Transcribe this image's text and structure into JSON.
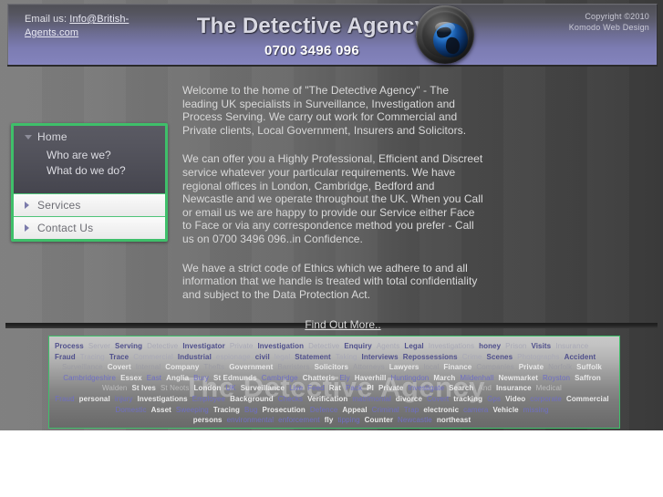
{
  "header": {
    "email_label": "Email us:",
    "email_link": "Info@British-Agents.com",
    "title": "The Detective Agency",
    "phone": "0700 3496 096",
    "copyright_line1": "Copyright ©2010",
    "copyright_line2": "Komodo Web Design",
    "logo_icon": "camera-lens-globe-icon",
    "accent_color": "#8080b8"
  },
  "sidebar": {
    "accent_color": "#3fbf6a",
    "home": {
      "label": "Home",
      "icon": "chevron-down-icon",
      "sub_items": [
        {
          "label": "Who are we?"
        },
        {
          "label": "What do we do?"
        }
      ]
    },
    "items": [
      {
        "label": "Services",
        "icon": "chevron-right-icon"
      },
      {
        "label": "Contact Us",
        "icon": "chevron-right-icon"
      }
    ]
  },
  "main": {
    "paragraphs": [
      "Welcome to the home of \"The Detective Agency\" - The leading UK specialists in Surveillance, Investigation and Process Serving. We carry out work for Commercial and Private clients, Local Government, Insurers and Solicitors.",
      "We can offer you a Highly Professional, Efficient and Discreet service whatever your particular requirements. We have regional offices in London, Cambridge, Bedford and Newcastle and we operate throughout the UK. When you Call or email us we are happy to provide our Service either Face to Face or via any correspondence method you prefer - Call us on 0700 3496 096..in Confidence.",
      "We have a strict code of Ethics which we adhere to and all information that we handle is treated with total confidentiality and subject to the Data Protection Act."
    ],
    "find_out_more": "Find Out More.."
  },
  "footer": {
    "watermark": "The Detective Agency",
    "border_color": "#3fbf6a",
    "tag_rows": [
      [
        {
          "text": "Process",
          "tier": "t-strong"
        },
        {
          "text": "Server",
          "tier": "t-faint"
        },
        {
          "text": "Serving",
          "tier": "t-strong"
        },
        {
          "text": "Detective",
          "tier": "t-faint"
        },
        {
          "text": "Investigator",
          "tier": "t-strong"
        },
        {
          "text": "Private",
          "tier": "t-faint"
        },
        {
          "text": "Investigation",
          "tier": "t-strong"
        },
        {
          "text": "Detective",
          "tier": "t-faint"
        },
        {
          "text": "Enquiry",
          "tier": "t-strong"
        },
        {
          "text": "Agents",
          "tier": "t-faint"
        },
        {
          "text": "Legal",
          "tier": "t-strong"
        },
        {
          "text": "Investigations",
          "tier": "t-faint"
        },
        {
          "text": "honey",
          "tier": "t-strong"
        },
        {
          "text": "Prison",
          "tier": "t-faint"
        },
        {
          "text": "Visits",
          "tier": "t-strong"
        },
        {
          "text": "Insurance",
          "tier": "t-faint"
        }
      ],
      [
        {
          "text": "Fraud",
          "tier": "t-strong"
        },
        {
          "text": "Tracing",
          "tier": "t-faint"
        },
        {
          "text": "Trace",
          "tier": "t-strong"
        },
        {
          "text": "Commercial",
          "tier": "t-faint"
        },
        {
          "text": "Industrial",
          "tier": "t-strong"
        },
        {
          "text": "espionage",
          "tier": "t-faint"
        },
        {
          "text": "civil",
          "tier": "t-strong"
        },
        {
          "text": "legal",
          "tier": "t-faint"
        },
        {
          "text": "Statement",
          "tier": "t-strong"
        },
        {
          "text": "Taking",
          "tier": "t-faint"
        },
        {
          "text": "Interviews",
          "tier": "t-strong"
        },
        {
          "text": "Repossessions",
          "tier": "t-strong"
        },
        {
          "text": "Crime",
          "tier": "t-faint"
        },
        {
          "text": "Scenes",
          "tier": "t-strong"
        },
        {
          "text": "Photographs",
          "tier": "t-faint"
        },
        {
          "text": "Accident",
          "tier": "t-strong"
        }
      ],
      [
        {
          "text": "Surveillance",
          "tier": "t-vfaint"
        },
        {
          "text": "Covert",
          "tier": "t-white"
        },
        {
          "text": "Internal",
          "tier": "t-vfaint"
        },
        {
          "text": "Company",
          "tier": "t-white"
        },
        {
          "text": "Thefts",
          "tier": "t-vfaint"
        },
        {
          "text": "Government",
          "tier": "t-white"
        },
        {
          "text": "Barristers",
          "tier": "t-vfaint"
        },
        {
          "text": "Solicitors",
          "tier": "t-white"
        },
        {
          "text": "Attorneys",
          "tier": "t-vfaint"
        },
        {
          "text": "Lawyers",
          "tier": "t-white"
        },
        {
          "text": "local",
          "tier": "t-vfaint"
        },
        {
          "text": "Finance",
          "tier": "t-white"
        },
        {
          "text": "Companies",
          "tier": "t-vfaint"
        },
        {
          "text": "Private",
          "tier": "t-white"
        },
        {
          "text": "Norfolk",
          "tier": "t-vfaint"
        },
        {
          "text": "Suffolk",
          "tier": "t-white"
        }
      ],
      [
        {
          "text": "Cambridgeshire",
          "tier": "t-blue"
        },
        {
          "text": "Essex",
          "tier": "t-white"
        },
        {
          "text": "East",
          "tier": "t-blue"
        },
        {
          "text": "Anglia",
          "tier": "t-white"
        },
        {
          "text": "Bury",
          "tier": "t-blue"
        },
        {
          "text": "St Edmunds",
          "tier": "t-white"
        },
        {
          "text": "Cambridge",
          "tier": "t-blue"
        },
        {
          "text": "Chatteris",
          "tier": "t-white"
        },
        {
          "text": "Ely",
          "tier": "t-blue"
        },
        {
          "text": "Haverhill",
          "tier": "t-white"
        },
        {
          "text": "Huntingdon",
          "tier": "t-blue"
        },
        {
          "text": "March",
          "tier": "t-white"
        },
        {
          "text": "Mildenhall",
          "tier": "t-blue"
        },
        {
          "text": "Newmarket",
          "tier": "t-white"
        },
        {
          "text": "Royston",
          "tier": "t-blue"
        },
        {
          "text": "Saffron",
          "tier": "t-white"
        }
      ],
      [
        {
          "text": "Walden",
          "tier": "t-wfaint"
        },
        {
          "text": "St Ives",
          "tier": "t-white"
        },
        {
          "text": "St Neots",
          "tier": "t-wfaint"
        },
        {
          "text": "London",
          "tier": "t-white"
        },
        {
          "text": "UK",
          "tier": "t-blue"
        },
        {
          "text": "Surveillance",
          "tier": "t-white"
        },
        {
          "text": "Live",
          "tier": "t-blue"
        },
        {
          "text": "Feed",
          "tier": "t-blue"
        },
        {
          "text": "Rat",
          "tier": "t-white"
        },
        {
          "text": "Pack",
          "tier": "t-blue"
        },
        {
          "text": "Pl",
          "tier": "t-white"
        },
        {
          "text": "Private",
          "tier": "t-white"
        },
        {
          "text": "Investigate",
          "tier": "t-blue"
        },
        {
          "text": "Search",
          "tier": "t-white"
        },
        {
          "text": "And",
          "tier": "t-wfaint"
        },
        {
          "text": "Insurance",
          "tier": "t-white"
        },
        {
          "text": "Medical",
          "tier": "t-wfaint"
        }
      ],
      [
        {
          "text": "Fraud",
          "tier": "t-blue"
        },
        {
          "text": "personal",
          "tier": "t-white"
        },
        {
          "text": "injury",
          "tier": "t-blue"
        },
        {
          "text": "Investigations",
          "tier": "t-white"
        },
        {
          "text": "Employee",
          "tier": "t-blue"
        },
        {
          "text": "Background",
          "tier": "t-white"
        },
        {
          "text": "Checks",
          "tier": "t-blue"
        },
        {
          "text": "Verification",
          "tier": "t-white"
        },
        {
          "text": "matrimonial",
          "tier": "t-blue"
        },
        {
          "text": "divorce",
          "tier": "t-white"
        },
        {
          "text": "Covert",
          "tier": "t-blue"
        },
        {
          "text": "tracking",
          "tier": "t-white"
        },
        {
          "text": "Gps",
          "tier": "t-blue"
        },
        {
          "text": "Video",
          "tier": "t-white"
        },
        {
          "text": "corporate",
          "tier": "t-blue"
        },
        {
          "text": "Commercial",
          "tier": "t-white"
        }
      ],
      [
        {
          "text": "Domestic",
          "tier": "t-blue"
        },
        {
          "text": "Asset",
          "tier": "t-white"
        },
        {
          "text": "Sweeping",
          "tier": "t-blue"
        },
        {
          "text": "Tracing",
          "tier": "t-white"
        },
        {
          "text": "Bug",
          "tier": "t-blue"
        },
        {
          "text": "Prosecution",
          "tier": "t-white"
        },
        {
          "text": "Defence",
          "tier": "t-blue"
        },
        {
          "text": "Appeal",
          "tier": "t-white"
        },
        {
          "text": "Criminal",
          "tier": "t-blue"
        },
        {
          "text": "Trap",
          "tier": "t-blue"
        },
        {
          "text": "electronic",
          "tier": "t-white"
        },
        {
          "text": "camera",
          "tier": "t-blue"
        },
        {
          "text": "Vehicle",
          "tier": "t-white"
        },
        {
          "text": "missing",
          "tier": "t-blue"
        }
      ],
      [
        {
          "text": "persons",
          "tier": "t-white"
        },
        {
          "text": "environmental",
          "tier": "t-blue"
        },
        {
          "text": "enforcement",
          "tier": "t-blue"
        },
        {
          "text": "fly",
          "tier": "t-white"
        },
        {
          "text": "tipping",
          "tier": "t-blue"
        },
        {
          "text": "Counter",
          "tier": "t-white"
        },
        {
          "text": "Newcastle",
          "tier": "t-blue"
        },
        {
          "text": "northeast",
          "tier": "t-white"
        }
      ]
    ]
  }
}
